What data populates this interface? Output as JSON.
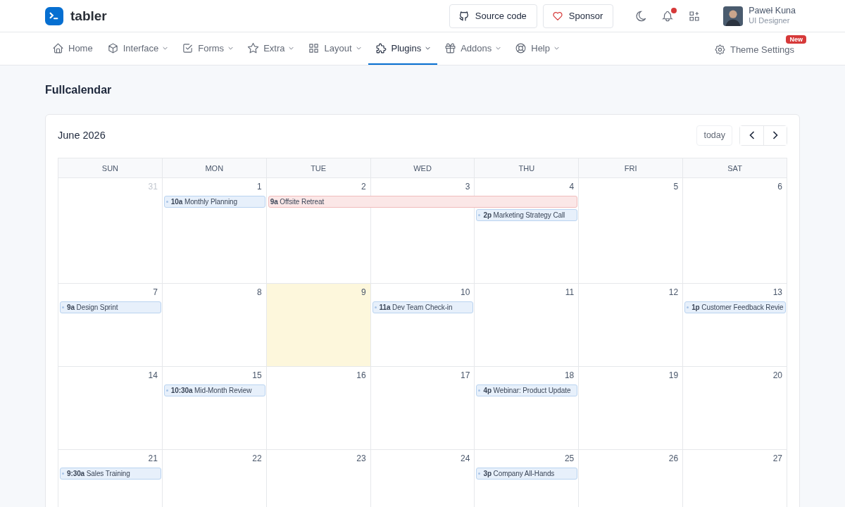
{
  "brand": {
    "name": "tabler"
  },
  "header_buttons": [
    {
      "kind": "github",
      "label": "Source code"
    },
    {
      "kind": "heart",
      "label": "Sponsor"
    }
  ],
  "notifications": {
    "unread": true
  },
  "user": {
    "name": "Paweł Kuna",
    "role": "UI Designer"
  },
  "nav": [
    {
      "label": "Home",
      "dropdown": false,
      "selected": false
    },
    {
      "label": "Interface",
      "dropdown": true,
      "selected": false
    },
    {
      "label": "Forms",
      "dropdown": true,
      "selected": false
    },
    {
      "label": "Extra",
      "dropdown": true,
      "selected": false
    },
    {
      "label": "Layout",
      "dropdown": true,
      "selected": false
    },
    {
      "label": "Plugins",
      "dropdown": true,
      "selected": true
    },
    {
      "label": "Addons",
      "dropdown": true,
      "selected": false
    },
    {
      "label": "Help",
      "dropdown": true,
      "selected": false
    }
  ],
  "theme_settings": {
    "label": "Theme Settings",
    "badge": "New"
  },
  "page_title": "Fullcalendar",
  "calendar": {
    "title": "June 2026",
    "today_button": "today",
    "weekdays": [
      "SUN",
      "MON",
      "TUE",
      "WED",
      "THU",
      "FRI",
      "SAT"
    ],
    "weeks": [
      {
        "days": [
          {
            "number": "31",
            "other_month": true,
            "today": false
          },
          {
            "number": "1",
            "other_month": false,
            "today": false
          },
          {
            "number": "2",
            "other_month": false,
            "today": false
          },
          {
            "number": "3",
            "other_month": false,
            "today": false
          },
          {
            "number": "4",
            "other_month": false,
            "today": false
          },
          {
            "number": "5",
            "other_month": false,
            "today": false
          },
          {
            "number": "6",
            "other_month": false,
            "today": false
          }
        ],
        "events": [
          {
            "kind": "timed",
            "time": "10a",
            "title": "Monthly Planning",
            "color": "#e7f0fb"
          },
          {
            "kind": "multi_day",
            "time": "9a",
            "title": "Offsite Retreat",
            "color": "#fbe7e7"
          },
          {
            "kind": "timed",
            "time": "2p",
            "title": "Marketing Strategy Call",
            "color": "#e7f0fb"
          }
        ]
      },
      {
        "days": [
          {
            "number": "7",
            "other_month": false,
            "today": false
          },
          {
            "number": "8",
            "other_month": false,
            "today": false
          },
          {
            "number": "9",
            "other_month": false,
            "today": true
          },
          {
            "number": "10",
            "other_month": false,
            "today": false
          },
          {
            "number": "11",
            "other_month": false,
            "today": false
          },
          {
            "number": "12",
            "other_month": false,
            "today": false
          },
          {
            "number": "13",
            "other_month": false,
            "today": false
          }
        ],
        "events": [
          {
            "kind": "timed",
            "time": "9a",
            "title": "Design Sprint",
            "color": "#e7f0fb"
          },
          {
            "kind": "timed",
            "time": "11a",
            "title": "Dev Team Check-in",
            "color": "#e7f0fb"
          },
          {
            "kind": "timed",
            "time": "1p",
            "title": "Customer Feedback Revie",
            "color": "#e7f0fb"
          }
        ]
      },
      {
        "days": [
          {
            "number": "14",
            "other_month": false,
            "today": false
          },
          {
            "number": "15",
            "other_month": false,
            "today": false
          },
          {
            "number": "16",
            "other_month": false,
            "today": false
          },
          {
            "number": "17",
            "other_month": false,
            "today": false
          },
          {
            "number": "18",
            "other_month": false,
            "today": false
          },
          {
            "number": "19",
            "other_month": false,
            "today": false
          },
          {
            "number": "20",
            "other_month": false,
            "today": false
          }
        ],
        "events": [
          {
            "kind": "timed",
            "time": "10:30a",
            "title": "Mid-Month Review",
            "color": "#e7f0fb"
          },
          {
            "kind": "timed",
            "time": "4p",
            "title": "Webinar: Product Update",
            "color": "#e7f0fb"
          }
        ]
      },
      {
        "days": [
          {
            "number": "21",
            "other_month": false,
            "today": false
          },
          {
            "number": "22",
            "other_month": false,
            "today": false
          },
          {
            "number": "23",
            "other_month": false,
            "today": false
          },
          {
            "number": "24",
            "other_month": false,
            "today": false
          },
          {
            "number": "25",
            "other_month": false,
            "today": false
          },
          {
            "number": "26",
            "other_month": false,
            "today": false
          },
          {
            "number": "27",
            "other_month": false,
            "today": false
          }
        ],
        "events": [
          {
            "kind": "timed",
            "time": "9:30a",
            "title": "Sales Training",
            "color": "#e7f0fb"
          },
          {
            "kind": "timed",
            "time": "3p",
            "title": "Company All-Hands",
            "color": "#e7f0fb"
          }
        ]
      }
    ]
  }
}
